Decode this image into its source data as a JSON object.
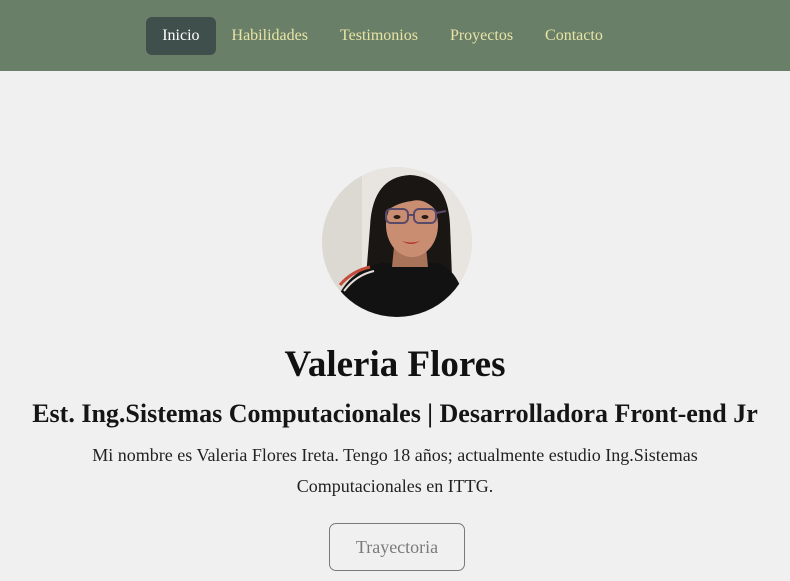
{
  "nav": {
    "items": [
      {
        "label": "Inicio",
        "active": true
      },
      {
        "label": "Habilidades",
        "active": false
      },
      {
        "label": "Testimonios",
        "active": false
      },
      {
        "label": "Proyectos",
        "active": false
      },
      {
        "label": "Contacto",
        "active": false
      }
    ]
  },
  "profile": {
    "name": "Valeria Flores",
    "subtitle": "Est. Ing.Sistemas Computacionales | Desarrolladora Front-end Jr",
    "bio": "Mi nombre es Valeria Flores Ireta. Tengo 18 años; actualmente estudio Ing.Sistemas Computacionales en ITTG.",
    "button_label": "Trayectoria"
  },
  "colors": {
    "navbar_bg": "#6a7f68",
    "nav_text": "#e8e4a6",
    "nav_active_bg": "#3f4f4c",
    "page_bg": "#f0f0f0"
  }
}
